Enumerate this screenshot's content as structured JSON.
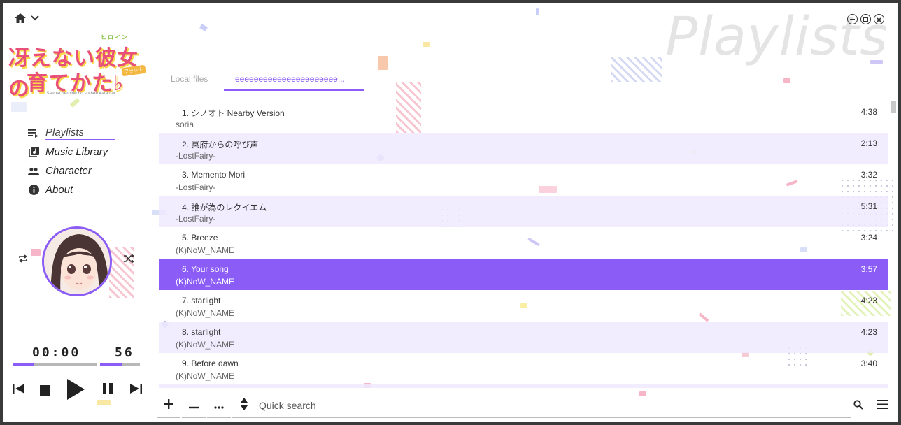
{
  "window": {
    "heading": "Playlists",
    "controls": {
      "minimize": "minimize-icon",
      "maximize": "maximize-icon",
      "close": "close-icon"
    }
  },
  "logo": {
    "line1": "冴えない彼女の",
    "line2": "育てかた♭",
    "ruby": "ヒロイン",
    "badge": "フラット",
    "subtitle": "Saenai heroine no sodate kata flat"
  },
  "nav": [
    {
      "label": "Playlists",
      "icon": "playlist-icon",
      "active": true
    },
    {
      "label": "Music Library",
      "icon": "library-icon",
      "active": false
    },
    {
      "label": "Character",
      "icon": "people-icon",
      "active": false
    },
    {
      "label": "About",
      "icon": "info-icon",
      "active": false
    }
  ],
  "player": {
    "time": "00:00",
    "volume": "56",
    "progress": 0.25,
    "volume_level": 0.56
  },
  "tabs": [
    {
      "label": "Local files",
      "active": false
    },
    {
      "label": "eeeeeeeeeeeeeeeeeeeeee...",
      "active": true
    }
  ],
  "tracks": [
    {
      "title": "1. シノオト Nearby Version",
      "artist": "soria",
      "duration": "4:38"
    },
    {
      "title": "2. 冥府からの呼び声",
      "artist": "-LostFairy-",
      "duration": "2:13"
    },
    {
      "title": "3. Memento Mori",
      "artist": "-LostFairy-",
      "duration": "3:32"
    },
    {
      "title": "4. 誰が為のレクイエム",
      "artist": "-LostFairy-",
      "duration": "5:31"
    },
    {
      "title": "5. Breeze",
      "artist": "(K)NoW_NAME",
      "duration": "3:24"
    },
    {
      "title": "6. Your song",
      "artist": "(K)NoW_NAME",
      "duration": "3:57"
    },
    {
      "title": "7. starlight",
      "artist": "(K)NoW_NAME",
      "duration": "4:23"
    },
    {
      "title": "8. starlight",
      "artist": "(K)NoW_NAME",
      "duration": "4:23"
    },
    {
      "title": "9. Before dawn",
      "artist": "(K)NoW_NAME",
      "duration": "3:40"
    }
  ],
  "selected_track": 5,
  "search": {
    "placeholder": "Quick search"
  },
  "colors": {
    "accent": "#8b5cf6",
    "alt_row": "#eeeaff"
  }
}
